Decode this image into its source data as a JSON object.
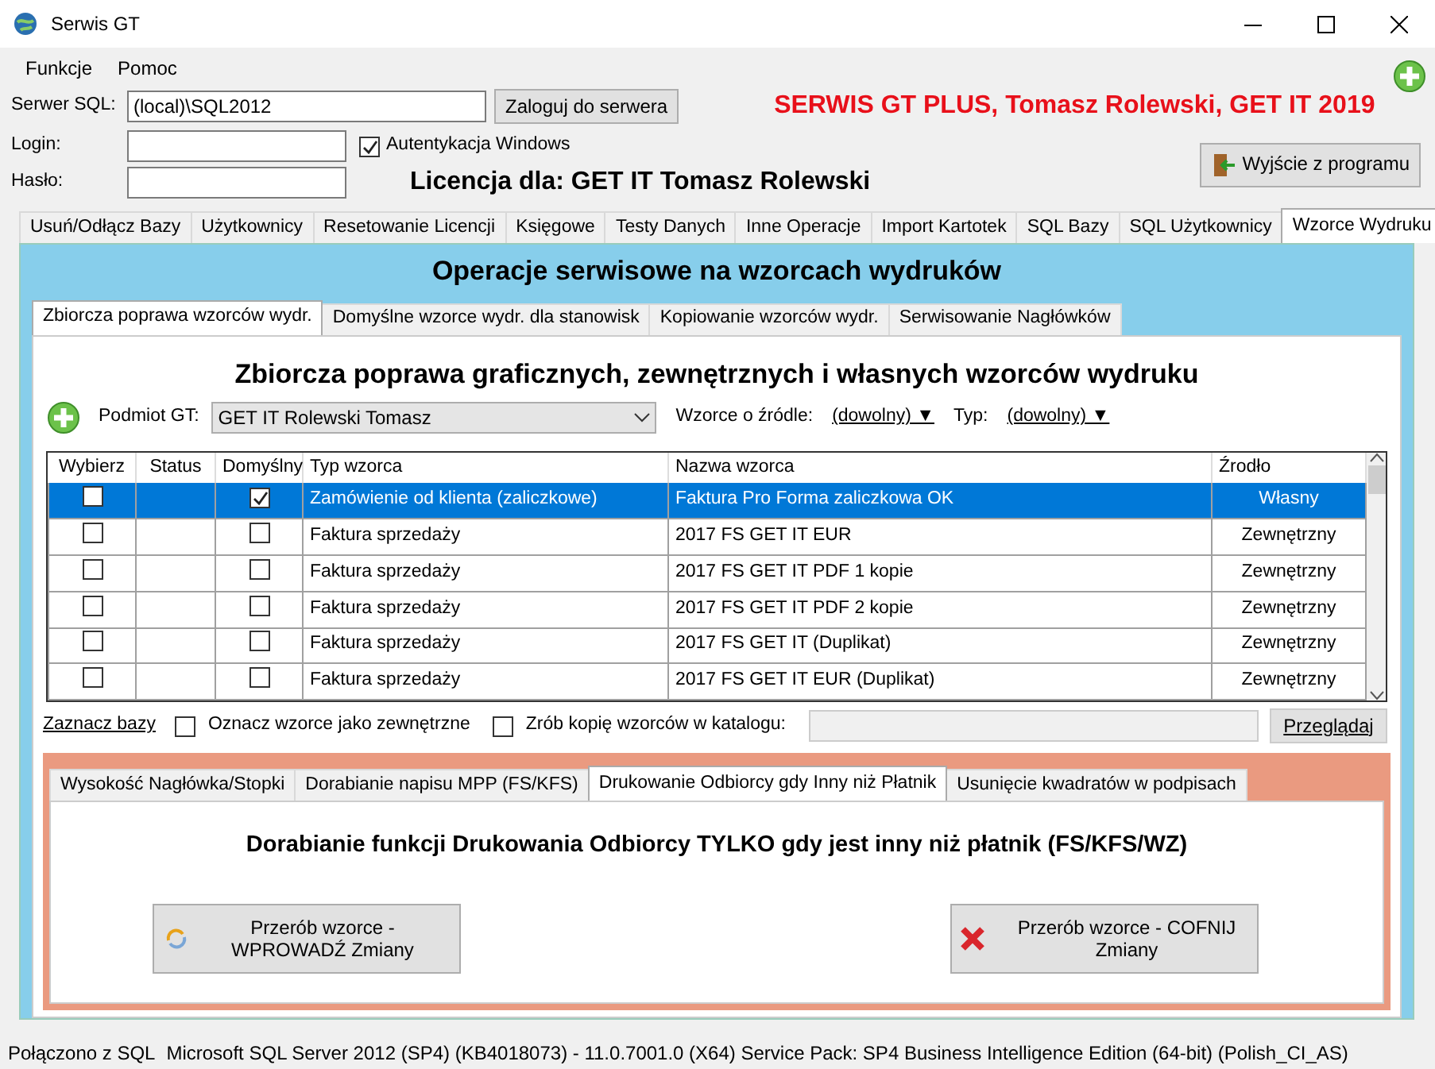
{
  "window": {
    "title": "Serwis GT"
  },
  "menu": [
    {
      "label": "Funkcje"
    },
    {
      "label": "Pomoc"
    }
  ],
  "connection": {
    "server_label": "Serwer SQL:",
    "server_value": "(local)\\SQL2012",
    "login_button": "Zaloguj do serwera",
    "login_label": "Login:",
    "password_label": "Hasło:",
    "windows_auth": {
      "label": "Autentykacja Windows",
      "checked": true
    }
  },
  "banner": "SERWIS GT PLUS, Tomasz Rolewski, GET IT 2019",
  "license": "Licencja dla: GET IT Tomasz Rolewski",
  "exit_button": "Wyjście z programu",
  "tabs": [
    {
      "label": "Usuń/Odłącz Bazy",
      "selected": false
    },
    {
      "label": "Użytkownicy",
      "selected": false
    },
    {
      "label": "Resetowanie Licencji",
      "selected": false
    },
    {
      "label": "Księgowe",
      "selected": false
    },
    {
      "label": "Testy Danych",
      "selected": false
    },
    {
      "label": "Inne Operacje",
      "selected": false
    },
    {
      "label": "Import Kartotek",
      "selected": false
    },
    {
      "label": "SQL Bazy",
      "selected": false
    },
    {
      "label": "SQL Użytkownicy",
      "selected": false
    },
    {
      "label": "Wzorce Wydruku",
      "selected": true
    }
  ],
  "panel": {
    "title": "Operacje serwisowe na wzorcach wydruków",
    "tabs": [
      {
        "label": "Zbiorcza poprawa wzorców wydr.",
        "selected": true
      },
      {
        "label": "Domyślne wzorce wydr. dla stanowisk",
        "selected": false
      },
      {
        "label": "Kopiowanie wzorców wydr.",
        "selected": false
      },
      {
        "label": "Serwisowanie Nagłówków",
        "selected": false
      }
    ],
    "heading": "Zbiorcza poprawa graficznych, zewnętrznych i własnych wzorców wydruku",
    "filters": {
      "subject_label": "Podmiot GT:",
      "subject_value": "GET IT Rolewski Tomasz",
      "source_label": "Wzorce o źródle:",
      "source_value": "(dowolny) ▼",
      "type_label": "Typ:",
      "type_value": "(dowolny) ▼"
    },
    "table": {
      "columns": [
        "Wybierz",
        "Status",
        "Domyślny",
        "Typ wzorca",
        "Nazwa wzorca",
        "Źrodło"
      ],
      "rows": [
        {
          "choose": false,
          "default": true,
          "type": "Zamówienie od klienta (zaliczkowe)",
          "name": "Faktura Pro Forma zaliczkowa OK",
          "source": "Własny",
          "selected": true
        },
        {
          "choose": false,
          "default": false,
          "type": "Faktura sprzedaży",
          "name": "2017 FS GET IT EUR",
          "source": "Zewnętrzny",
          "selected": false
        },
        {
          "choose": false,
          "default": false,
          "type": "Faktura sprzedaży",
          "name": "2017 FS GET IT PDF 1 kopie",
          "source": "Zewnętrzny",
          "selected": false
        },
        {
          "choose": false,
          "default": false,
          "type": "Faktura sprzedaży",
          "name": "2017 FS GET IT PDF 2 kopie",
          "source": "Zewnętrzny",
          "selected": false
        },
        {
          "choose": false,
          "default": false,
          "type": "Faktura sprzedaży",
          "name": "2017 FS GET IT (Duplikat)",
          "source": "Zewnętrzny",
          "selected": false
        },
        {
          "choose": false,
          "default": false,
          "type": "Faktura sprzedaży",
          "name": "2017 FS GET IT EUR (Duplikat)",
          "source": "Zewnętrzny",
          "selected": false
        }
      ]
    },
    "mark_link": "Zaznacz bazy",
    "mark_external": {
      "label": "Oznacz wzorce jako zewnętrzne",
      "checked": false
    },
    "copy_to_folder": {
      "label": "Zrób kopię wzorców w katalogu:",
      "checked": false
    },
    "browse_button": "Przeglądaj",
    "sub_panel": {
      "tabs": [
        {
          "label": "Wysokość Nagłówka/Stopki",
          "selected": false
        },
        {
          "label": "Dorabianie napisu MPP (FS/KFS)",
          "selected": false
        },
        {
          "label": "Drukowanie Odbiorcy gdy Inny niż Płatnik",
          "selected": true
        },
        {
          "label": "Usunięcie kwadratów w podpisach",
          "selected": false
        }
      ],
      "heading": "Dorabianie funkcji Drukowania Odbiorcy TYLKO gdy jest inny niż płatnik (FS/KFS/WZ)",
      "apply_button": "Przerób wzorce - WPROWADŹ Zmiany",
      "revert_button": "Przerób wzorce - COFNIJ Zmiany"
    }
  },
  "status_bar": [
    {
      "text": "Połączono z SQL"
    },
    {
      "text": "Microsoft SQL Server 2012 (SP4) (KB4018073) - 11.0.7001.0 (X64)  Service Pack: SP4 Business Intelligence Edition (64-bit) (Polish_CI_AS)"
    }
  ]
}
